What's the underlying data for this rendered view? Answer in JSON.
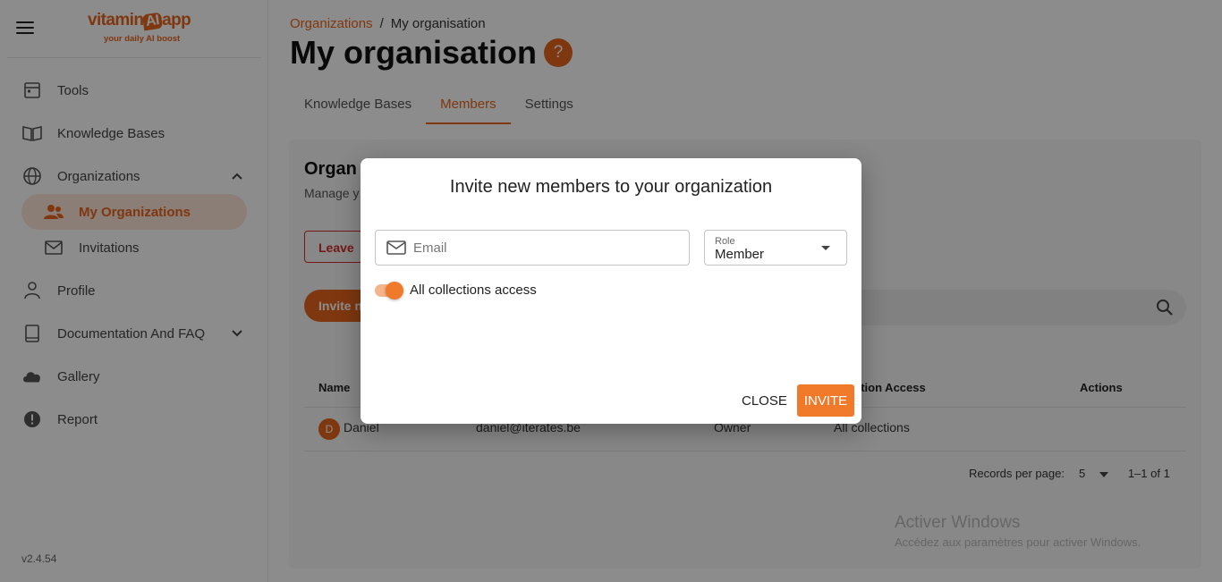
{
  "app": {
    "logo_word": "vitamin",
    "logo_ai": "AI",
    "logo_app": "app",
    "tagline": "your daily AI boost",
    "version": "v2.4.54",
    "accent_color": "#e8651d"
  },
  "sidebar": {
    "items": [
      {
        "label": "Tools",
        "icon": "calendar-icon"
      },
      {
        "label": "Knowledge Bases",
        "icon": "book-open-icon"
      },
      {
        "label": "Organizations",
        "icon": "globe-icon"
      },
      {
        "label": "My Organizations",
        "icon": "people-icon"
      },
      {
        "label": "Invitations",
        "icon": "mail-icon"
      },
      {
        "label": "Profile",
        "icon": "person-icon"
      },
      {
        "label": "Documentation And FAQ",
        "icon": "book-icon"
      },
      {
        "label": "Gallery",
        "icon": "cloud-icon"
      },
      {
        "label": "Report",
        "icon": "alert-icon"
      }
    ]
  },
  "breadcrumb": {
    "parent": "Organizations",
    "separator": "/",
    "current": "My organisation"
  },
  "page": {
    "title": "My organisation",
    "help": "?"
  },
  "tabs": [
    {
      "label": "Knowledge Bases"
    },
    {
      "label": "Members"
    },
    {
      "label": "Settings"
    }
  ],
  "card": {
    "title": "Organ",
    "subtitle": "Manage y",
    "leave_label": "Leave",
    "invite_label": "Invite n"
  },
  "table": {
    "headers": {
      "name": "Name",
      "collection_access": "ction Access",
      "actions": "Actions"
    },
    "rows": [
      {
        "initial": "D",
        "name": "Daniel",
        "email": "daniel@iterates.be",
        "role": "Owner",
        "access": "All collections"
      }
    ]
  },
  "pagination": {
    "records_label": "Records per page:",
    "per_page": "5",
    "range": "1–1 of 1"
  },
  "watermark": {
    "title": "Activer Windows",
    "subtitle": "Accédez aux paramètres pour activer Windows."
  },
  "dialog": {
    "title": "Invite new members to your organization",
    "email_placeholder": "Email",
    "email_value": "",
    "role_label": "Role",
    "role_value": "Member",
    "toggle_label": "All collections access",
    "toggle_on": true,
    "close_label": "CLOSE",
    "invite_label": "INVITE"
  }
}
